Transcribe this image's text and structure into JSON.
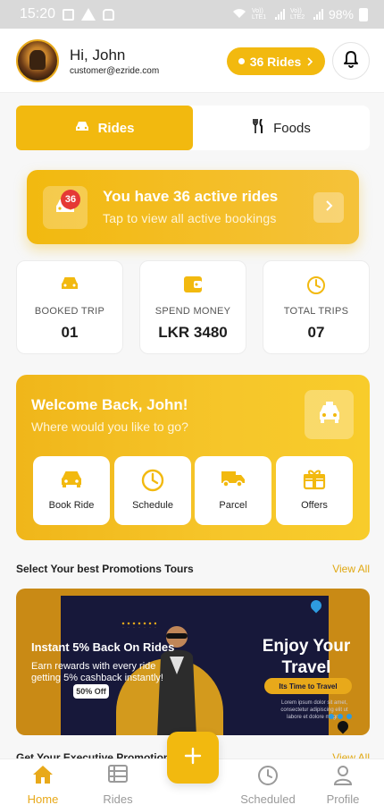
{
  "status_bar": {
    "time": "15:20",
    "network_1": "Vo)) LTE1",
    "network_2": "Vo)) LTE2",
    "battery": "98%"
  },
  "header": {
    "greeting": "Hi, John",
    "email": "customer@ezride.com",
    "rides_pill": "36 Rides",
    "bell_icon": "bell-icon"
  },
  "tabs": [
    {
      "label": "Rides",
      "icon": "car-icon",
      "active": true
    },
    {
      "label": "Foods",
      "icon": "fork-knife-icon",
      "active": false
    }
  ],
  "active_rides_banner": {
    "badge": "36",
    "title": "You have 36 active rides",
    "subtitle": "Tap to view all active bookings"
  },
  "stats": [
    {
      "label": "BOOKED TRIP",
      "value": "01",
      "icon": "car-icon"
    },
    {
      "label": "SPEND MONEY",
      "value": "LKR 3480",
      "icon": "wallet-icon"
    },
    {
      "label": "TOTAL TRIPS",
      "value": "07",
      "icon": "clock-icon"
    }
  ],
  "welcome": {
    "title": "Welcome Back, John!",
    "subtitle": "Where would you like to go?",
    "actions": [
      {
        "label": "Book Ride",
        "icon": "car-icon"
      },
      {
        "label": "Schedule",
        "icon": "clock-icon"
      },
      {
        "label": "Parcel",
        "icon": "truck-icon"
      },
      {
        "label": "Offers",
        "icon": "gift-icon"
      }
    ]
  },
  "promotions": {
    "section_title": "Select Your best Promotions Tours",
    "view_all": "View All",
    "banner": {
      "headline": "Instant 5% Back On Rides",
      "description": "Earn rewards with every ride getting 5% cashback instantly!",
      "offer_tag": "50% Off",
      "poster_title": "Enjoy Your Travel",
      "poster_pill": "Its Time to Travel",
      "poster_small_text": "Lorem ipsum dolor sit amet, consectetur adipiscing elit ut labore et dolore magna"
    }
  },
  "second_section": {
    "title": "Get Your Executive Promotions",
    "view_all": "View All"
  },
  "bottom_nav": [
    {
      "label": "Home",
      "icon": "home-icon",
      "active": true
    },
    {
      "label": "Rides",
      "icon": "list-icon",
      "active": false
    },
    {
      "label": "Scheduled",
      "icon": "clock-icon",
      "active": false
    },
    {
      "label": "Profile",
      "icon": "user-icon",
      "active": false
    }
  ],
  "colors": {
    "accent": "#f2b90f",
    "badge_red": "#e53935",
    "poster_navy": "#17183a"
  }
}
